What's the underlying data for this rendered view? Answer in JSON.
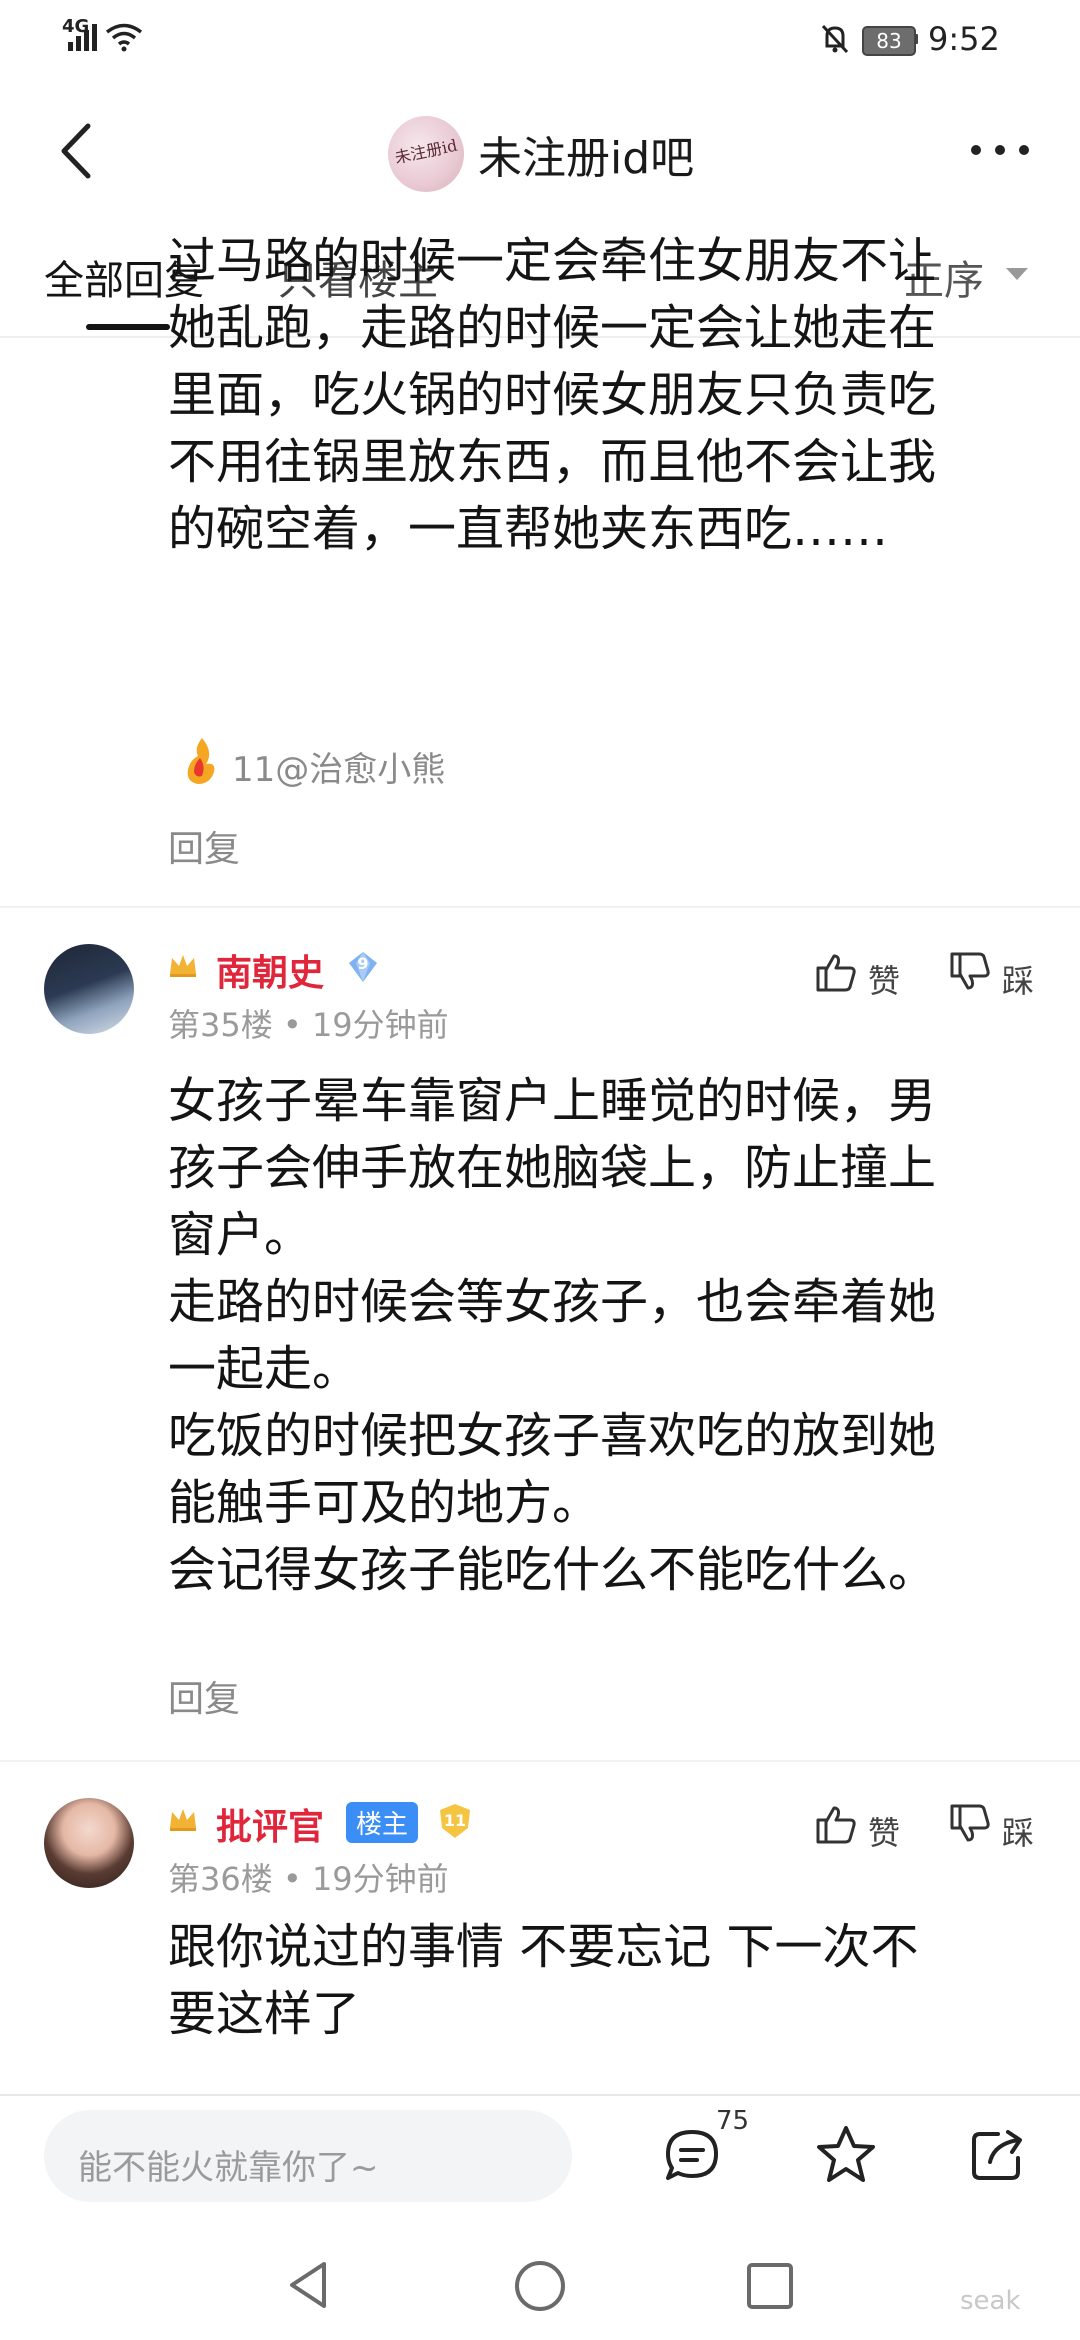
{
  "status_bar": {
    "network": "4G",
    "battery": "83",
    "time": "9:52"
  },
  "header": {
    "title": "未注册id吧",
    "avatar_text": "未注册id"
  },
  "tabs": {
    "all": "全部回复",
    "owner_only": "只看楼主",
    "sort": "正序"
  },
  "floor_34_tail": {
    "content": "过马路的时候一定会牵住女朋友不让\n她乱跑，走路的时候一定会让她走在\n里面，吃火锅的时候女朋友只负责吃\n不用往锅里放东西，而且他不会让我\n的碗空着，一直帮她夹东西吃……",
    "sub_reply_user": "11@治愈小熊",
    "reply": "回复"
  },
  "floor_35": {
    "user": "南朝史",
    "level": "9",
    "meta": "第35楼 • 19分钟前",
    "like": "赞",
    "dislike": "踩",
    "content": "女孩子晕车靠窗户上睡觉的时候，男\n孩子会伸手放在她脑袋上，防止撞上\n窗户。\n走路的时候会等女孩子，也会牵着她\n一起走。\n吃饭的时候把女孩子喜欢吃的放到她\n能触手可及的地方。\n会记得女孩子能吃什么不能吃什么。",
    "reply": "回复"
  },
  "floor_36": {
    "user": "批评官",
    "owner_tag": "楼主",
    "level": "11",
    "meta": "第36楼 • 19分钟前",
    "like": "赞",
    "dislike": "踩",
    "content": "跟你说过的事情 不要忘记 下一次不\n要这样了"
  },
  "bottom_bar": {
    "placeholder": "能不能火就靠你了~",
    "comment_count": "75"
  },
  "watermark": "seak",
  "colors": {
    "username_red": "#e0263a",
    "owner_blue": "#3a8ef6",
    "meta_gray": "#9a9a9a"
  }
}
